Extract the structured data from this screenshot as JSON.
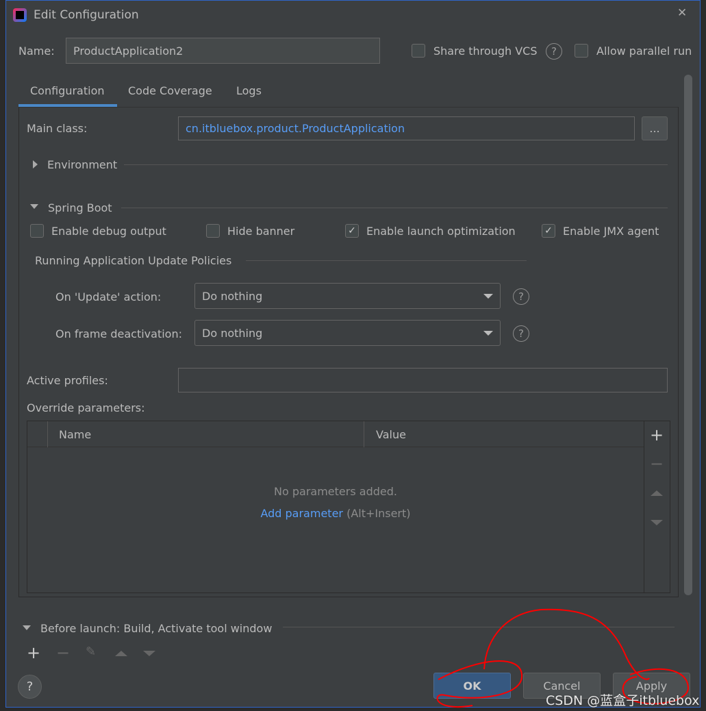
{
  "window": {
    "title": "Edit Configuration",
    "close": "✕"
  },
  "name": {
    "label": "Name:",
    "value": "ProductApplication2"
  },
  "share_vcs": {
    "label": "Share through VCS",
    "checked": false
  },
  "allow_parallel": {
    "label": "Allow parallel run",
    "checked": false
  },
  "tabs": [
    {
      "label": "Configuration",
      "active": true
    },
    {
      "label": "Code Coverage"
    },
    {
      "label": "Logs"
    }
  ],
  "main_class": {
    "label": "Main class:",
    "value": "cn.itbluebox.product.ProductApplication",
    "browse": "..."
  },
  "environment": {
    "label": "Environment",
    "expanded": false
  },
  "spring_boot": {
    "label": "Spring Boot",
    "expanded": true,
    "options": [
      {
        "label": "Enable debug output",
        "checked": false
      },
      {
        "label": "Hide banner",
        "checked": false
      },
      {
        "label": "Enable launch optimization",
        "checked": true
      },
      {
        "label": "Enable JMX agent",
        "checked": true
      }
    ]
  },
  "policies": {
    "title": "Running Application Update Policies",
    "update_action": {
      "label": "On 'Update' action:",
      "value": "Do nothing"
    },
    "frame_deactivation": {
      "label": "On frame deactivation:",
      "value": "Do nothing"
    }
  },
  "active_profiles": {
    "label": "Active profiles:",
    "value": ""
  },
  "override": {
    "label": "Override parameters:",
    "columns": [
      "Name",
      "Value"
    ],
    "empty": "No parameters added.",
    "add_link": "Add parameter",
    "add_shortcut": "(Alt+Insert)"
  },
  "before_launch": {
    "label": "Before launch: Build, Activate tool window"
  },
  "buttons": {
    "ok": "OK",
    "cancel": "Cancel",
    "apply": "Apply",
    "help": "?"
  },
  "watermark": "CSDN @蓝盒子itbluebox",
  "colors": {
    "accent": "#4a88c7",
    "link": "#589df6",
    "annotation": "#ff0000",
    "ok_bg": "#365880"
  }
}
